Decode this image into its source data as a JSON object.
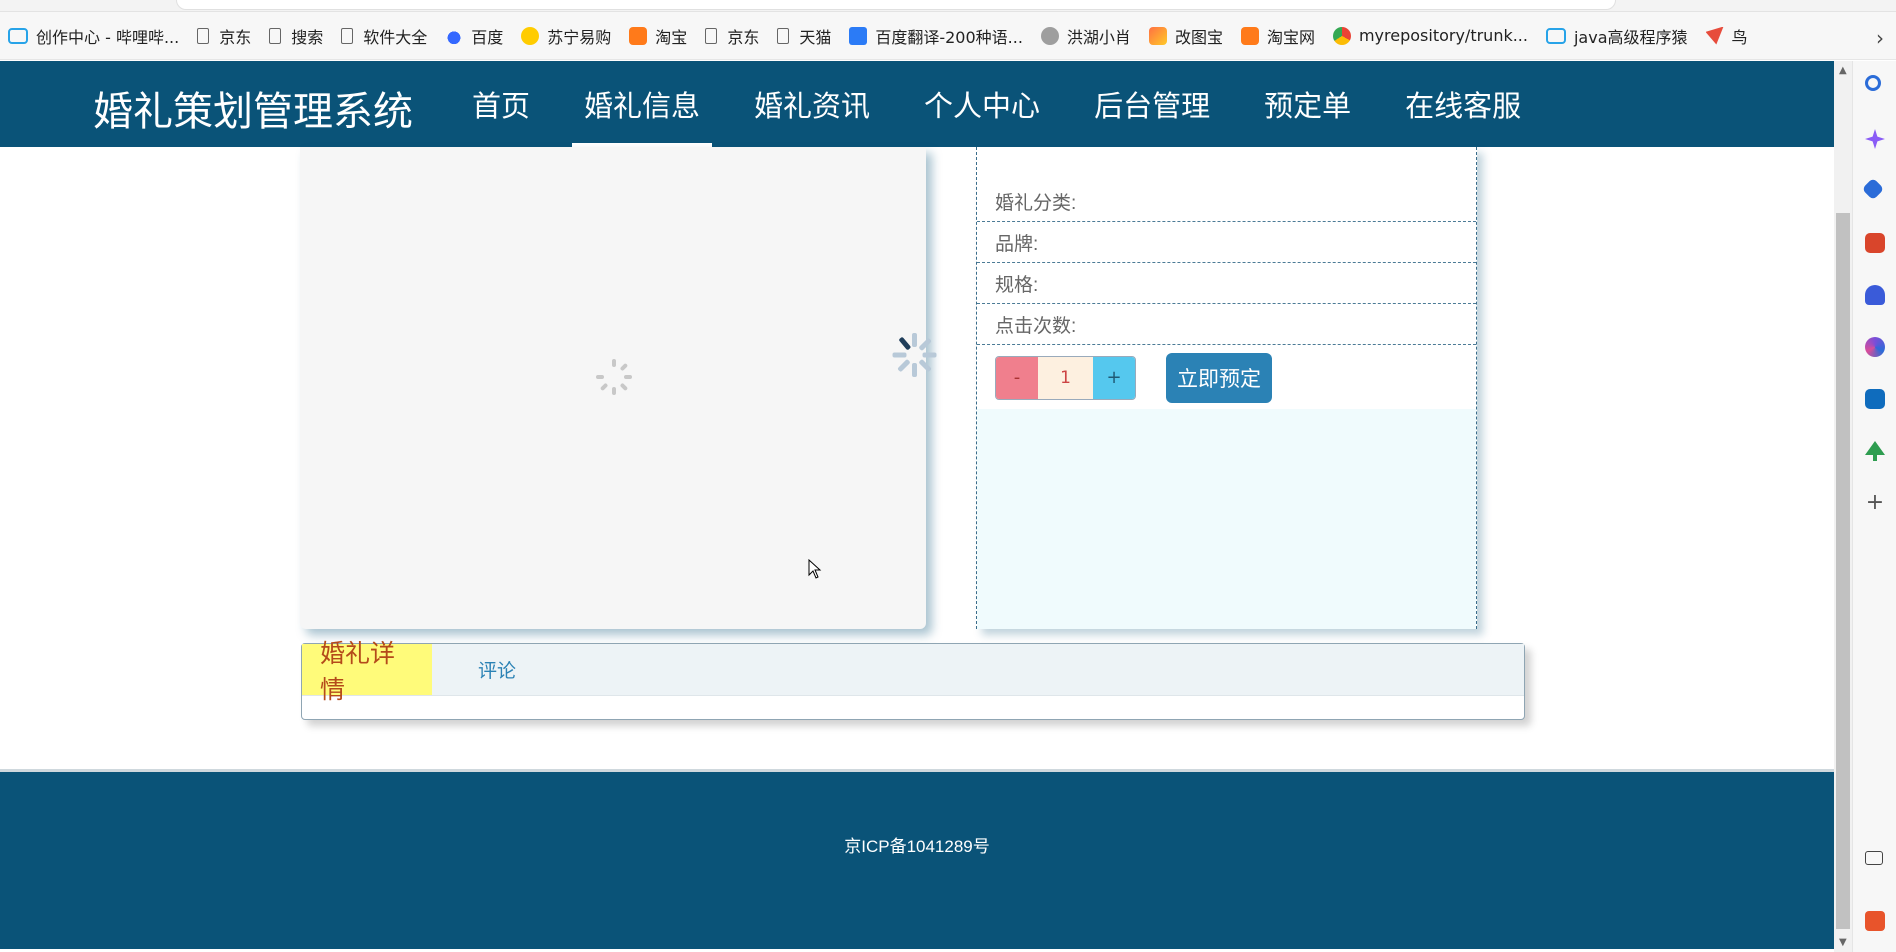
{
  "bookmarks": [
    {
      "label": "创作中心 - 哔哩哔...",
      "icon": "bilibili-icon"
    },
    {
      "label": "京东",
      "icon": "page-icon"
    },
    {
      "label": "搜索",
      "icon": "page-icon"
    },
    {
      "label": "软件大全",
      "icon": "page-icon"
    },
    {
      "label": "百度",
      "icon": "baidu-icon"
    },
    {
      "label": "苏宁易购",
      "icon": "suning-icon"
    },
    {
      "label": "淘宝",
      "icon": "taobao-icon"
    },
    {
      "label": "京东",
      "icon": "page-icon"
    },
    {
      "label": "天猫",
      "icon": "page-icon"
    },
    {
      "label": "百度翻译-200种语...",
      "icon": "baidu-translate-icon"
    },
    {
      "label": "洪湖小肖",
      "icon": "avatar-icon"
    },
    {
      "label": "改图宝",
      "icon": "gaitubao-icon"
    },
    {
      "label": "淘宝网",
      "icon": "taobao-icon"
    },
    {
      "label": "myrepository/trunk...",
      "icon": "chrome-icon"
    },
    {
      "label": "java高级程序猿",
      "icon": "bilibili-icon"
    },
    {
      "label": "鸟",
      "icon": "bird-icon"
    }
  ],
  "header": {
    "site_title": "婚礼策划管理系统",
    "nav": [
      "首页",
      "婚礼信息",
      "婚礼资讯",
      "个人中心",
      "后台管理",
      "预定单",
      "在线客服"
    ],
    "active_nav": "婚礼信息"
  },
  "info": {
    "category_label": "婚礼分类:",
    "brand_label": "品牌:",
    "spec_label": "规格:",
    "clicks_label": "点击次数:",
    "minus": "-",
    "quantity": "1",
    "plus": "+",
    "reserve_button": "立即预定"
  },
  "tabs": {
    "detail": "婚礼详情",
    "comments": "评论"
  },
  "footer": {
    "icp": "京ICP备1041289号"
  },
  "colors": {
    "header_bg": "#0a5378",
    "accent": "#2b82b5",
    "tab_active": "#fffb7a"
  }
}
